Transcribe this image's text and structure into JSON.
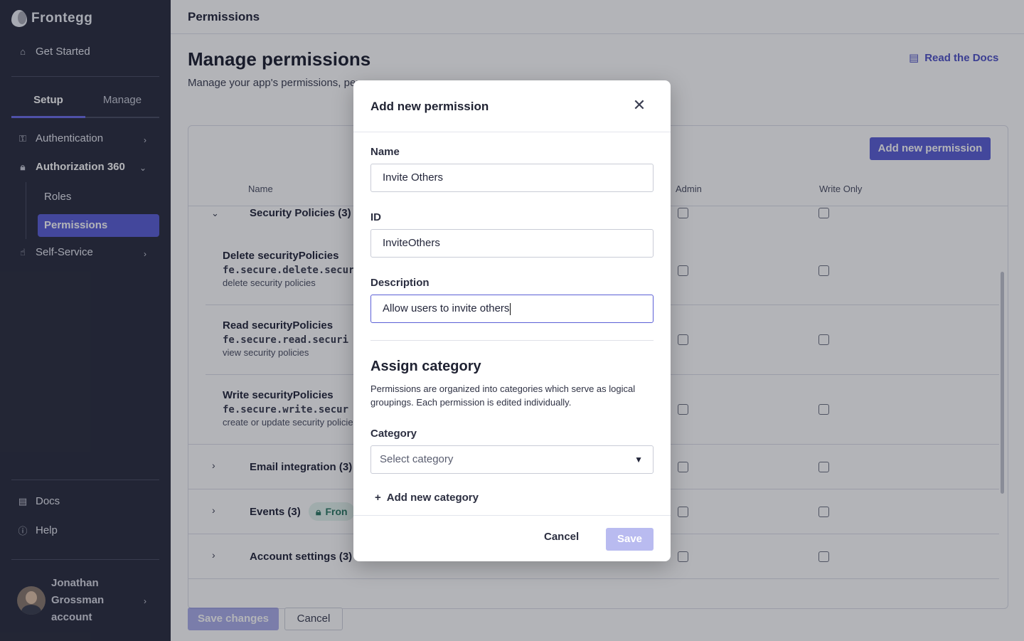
{
  "app": {
    "brand": "Frontegg"
  },
  "sidebar": {
    "get_started": "Get Started",
    "tabs": [
      {
        "label": "Setup"
      },
      {
        "label": "Manage"
      }
    ],
    "items": [
      {
        "label": "Authentication"
      },
      {
        "label": "Authorization 360"
      },
      {
        "label": "Roles"
      },
      {
        "label": "Permissions"
      },
      {
        "label": "Self-Service"
      }
    ],
    "bottom": [
      {
        "label": "Docs"
      },
      {
        "label": "Help"
      }
    ],
    "user": {
      "name": "Jonathan Grossman account"
    }
  },
  "header": {
    "title": "Permissions"
  },
  "page": {
    "title": "Manage permissions",
    "subtitle": "Manage your app's permissions, per",
    "docs_link": "Read the Docs"
  },
  "table": {
    "add_button": "Add new permission",
    "columns": {
      "name": "Name",
      "admin": "Admin",
      "write_only": "Write Only"
    },
    "groups": [
      {
        "name": "Security Policies (3)"
      },
      {
        "name": "Email integration (3)"
      },
      {
        "name": "Events (3)"
      },
      {
        "name": "Account settings (3)"
      }
    ],
    "events_badge": "Fron",
    "permissions": [
      {
        "name": "Delete securityPolicies",
        "key": "fe.secure.delete.secur",
        "desc": "delete security policies"
      },
      {
        "name": "Read securityPolicies",
        "key": "fe.secure.read.securi",
        "desc": "view security policies"
      },
      {
        "name": "Write securityPolicies",
        "key": "fe.secure.write.secur",
        "desc": "create or update security policie"
      }
    ]
  },
  "footer": {
    "save": "Save changes",
    "cancel": "Cancel"
  },
  "modal": {
    "title": "Add new permission",
    "name_label": "Name",
    "name_value": "Invite Others",
    "id_label": "ID",
    "id_value": "InviteOthers",
    "description_label": "Description",
    "description_value": "Allow users to invite others",
    "assign_title": "Assign category",
    "assign_text": "Permissions are organized into categories which serve as logical groupings. Each permission is edited individually.",
    "category_label": "Category",
    "category_placeholder": "Select category",
    "add_category": "Add new category",
    "cancel": "Cancel",
    "save": "Save"
  },
  "colors": {
    "accent": "#5b5fd6",
    "sidebar_bg": "#2a2d3e",
    "badge_green": "#2b7a63"
  }
}
